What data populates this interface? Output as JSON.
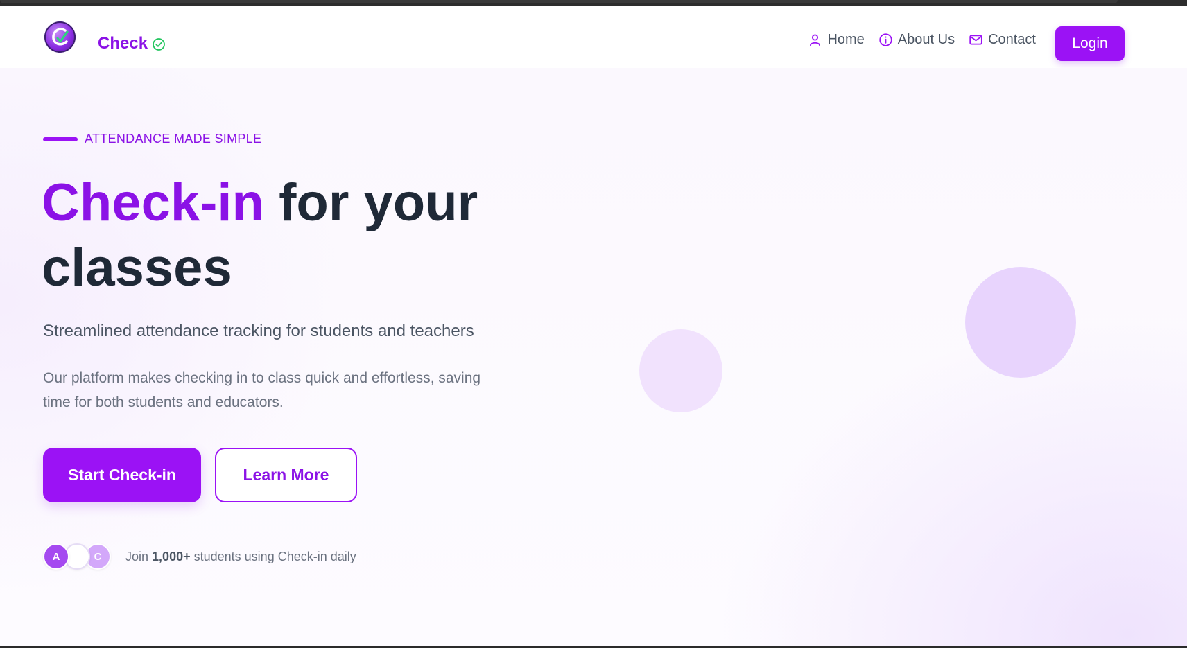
{
  "brand": {
    "name": "Check",
    "logo_icon": "check-logo-icon",
    "badge_icon": "check-circle-icon"
  },
  "nav": {
    "items": [
      {
        "label": "Home",
        "icon": "user-icon"
      },
      {
        "label": "About Us",
        "icon": "info-icon"
      },
      {
        "label": "Contact",
        "icon": "mail-icon"
      }
    ],
    "login_label": "Login"
  },
  "hero": {
    "eyebrow": "ATTENDANCE MADE SIMPLE",
    "headline_accent": "Check-in",
    "headline_rest": "for your classes",
    "subtitle": "Streamlined attendance tracking for students and teachers",
    "description": "Our platform makes checking in to class quick and effortless, saving time for both students and educators.",
    "primary_button": "Start Check-in",
    "secondary_button": "Learn More",
    "avatars": [
      "A",
      "",
      "C"
    ],
    "social_prefix": "Join",
    "social_count": "1,000+",
    "social_suffix": "students using Check-in daily"
  },
  "colors": {
    "accent": "#9b12f5",
    "accent_text": "#8b12e6",
    "heading": "#1f2937",
    "body": "#4b5563",
    "muted": "#6b7280"
  }
}
